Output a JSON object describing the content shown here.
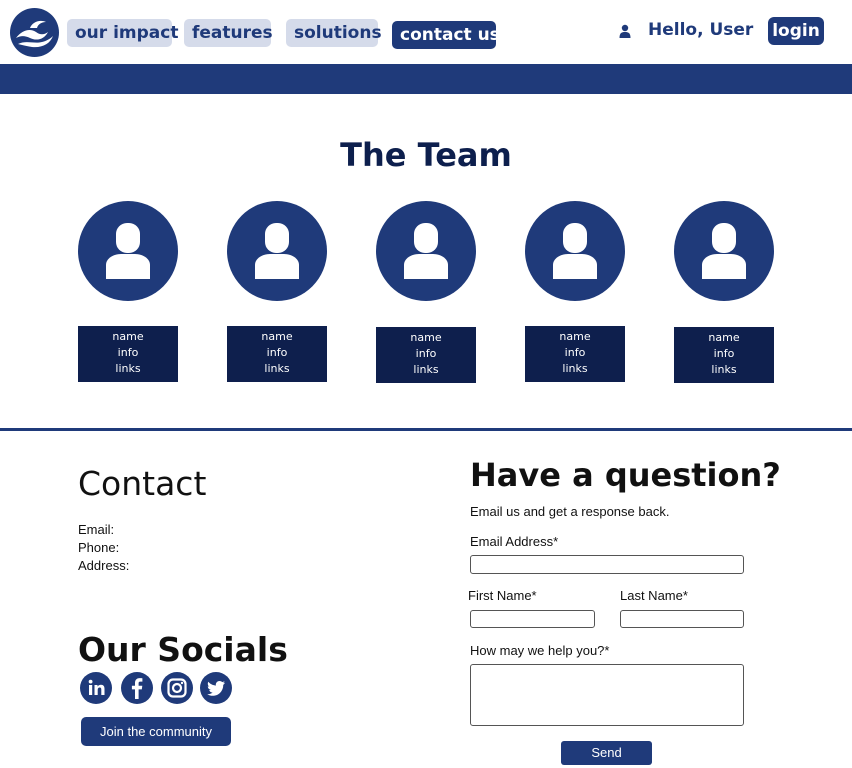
{
  "header": {
    "nav": [
      {
        "label": "our impact"
      },
      {
        "label": "features"
      },
      {
        "label": "solutions"
      },
      {
        "label": "contact us"
      }
    ],
    "greeting": "Hello, User",
    "login_label": "login",
    "logo_icon": "wave-logo-icon",
    "user_icon": "user-icon"
  },
  "team": {
    "title": "The Team",
    "avatar_icon": "person-icon",
    "members": [
      {
        "name": "name",
        "info": "info",
        "links": "links"
      },
      {
        "name": "name",
        "info": "info",
        "links": "links"
      },
      {
        "name": "name",
        "info": "info",
        "links": "links"
      },
      {
        "name": "name",
        "info": "info",
        "links": "links"
      },
      {
        "name": "name",
        "info": "info",
        "links": "links"
      }
    ]
  },
  "contact": {
    "heading": "Contact",
    "email_label": "Email:",
    "phone_label": "Phone:",
    "address_label": "Address:"
  },
  "socials": {
    "heading": "Our Socials",
    "icons": [
      "linkedin-icon",
      "facebook-icon",
      "instagram-icon",
      "twitter-icon"
    ],
    "join_label": "Join the community"
  },
  "form": {
    "heading": "Have a question?",
    "subheading": "Email us and get a response back.",
    "email_label": "Email Address*",
    "email_value": "",
    "first_name_label": "First Name*",
    "first_name_value": "",
    "last_name_label": "Last Name*",
    "last_name_value": "",
    "message_label": "How may we help you?*",
    "message_value": "",
    "send_label": "Send"
  },
  "colors": {
    "primary": "#1f3a7a",
    "dark_navy": "#0e1f4d",
    "pill_bg": "#d5dbea",
    "background": "#ffffff"
  }
}
